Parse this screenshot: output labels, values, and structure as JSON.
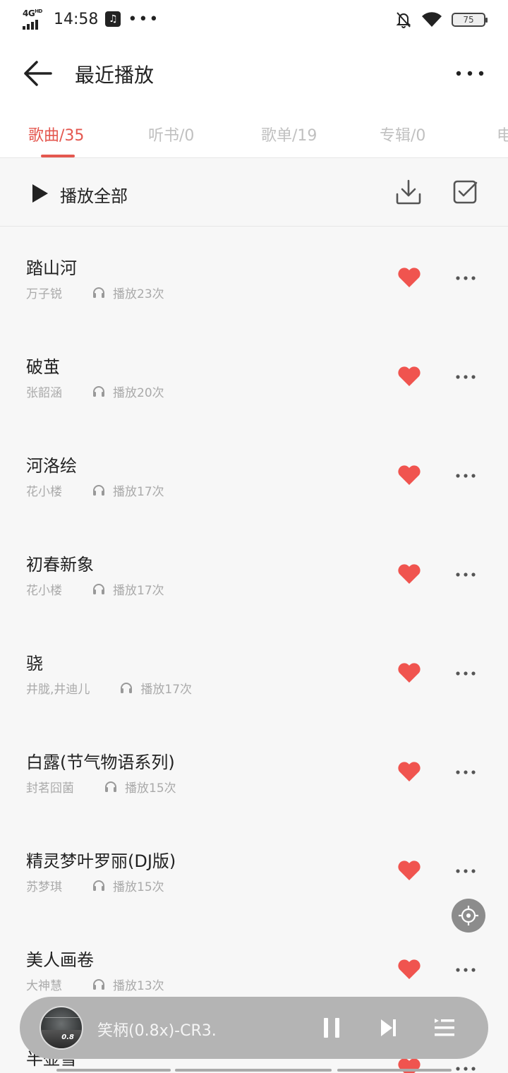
{
  "status_bar": {
    "network": "4G",
    "network_sup": "HD",
    "time": "14:58",
    "music_badge": "♫",
    "dots": "•••",
    "battery": "75"
  },
  "header": {
    "title": "最近播放"
  },
  "tabs": [
    {
      "label": "歌曲/35",
      "active": true
    },
    {
      "label": "听书/0",
      "active": false
    },
    {
      "label": "歌单/19",
      "active": false
    },
    {
      "label": "专辑/0",
      "active": false
    },
    {
      "label": "电",
      "active": false
    }
  ],
  "toolbar": {
    "play_all_label": "播放全部"
  },
  "songs": [
    {
      "title": "踏山河",
      "artist": "万子锐",
      "plays": "播放23次"
    },
    {
      "title": "破茧",
      "artist": "张韶涵",
      "plays": "播放20次"
    },
    {
      "title": "河洛绘",
      "artist": "花小楼",
      "plays": "播放17次"
    },
    {
      "title": "初春新象",
      "artist": "花小楼",
      "plays": "播放17次"
    },
    {
      "title": "骁",
      "artist": "井胧,井迪儿",
      "plays": "播放17次"
    },
    {
      "title": "白露(节气物语系列)",
      "artist": "封茗囧菌",
      "plays": "播放15次"
    },
    {
      "title": "精灵梦叶罗丽(DJ版)",
      "artist": "苏梦琪",
      "plays": "播放15次"
    },
    {
      "title": "美人画卷",
      "artist": "大神慧",
      "plays": "播放13次"
    },
    {
      "title": "半壶雪",
      "artist": "",
      "plays": ""
    }
  ],
  "player": {
    "now_playing": "笑柄(0.8x)-CR3.",
    "cover_speed": "0.8"
  },
  "colors": {
    "accent": "#e4574f",
    "heart": "#f0544f",
    "background": "#f7f7f7"
  }
}
